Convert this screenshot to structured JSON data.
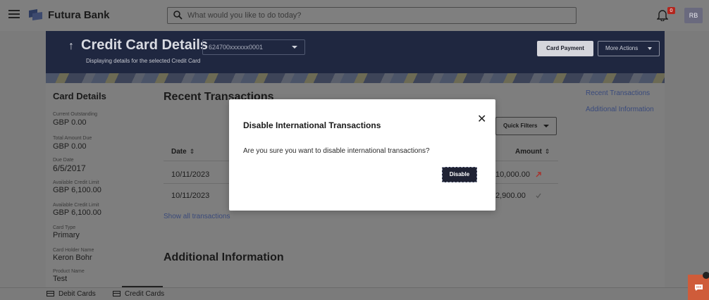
{
  "header": {
    "brand": "Futura Bank",
    "search_placeholder": "What would you like to do today?",
    "notification_count": "0",
    "avatar_initials": "RB"
  },
  "hero": {
    "title": "Credit Card Details",
    "subtitle": "Displaying details for the selected Credit Card",
    "selected_card": "624700xxxxxx0001",
    "card_payment_label": "Card Payment",
    "more_actions_label": "More Actions"
  },
  "card_details": {
    "title": "Card Details",
    "fields": [
      {
        "label": "Current Outstanding",
        "value": "GBP 0.00"
      },
      {
        "label": "Total Amount Due",
        "value": "GBP 0.00"
      },
      {
        "label": "Due Date",
        "value": "6/5/2017"
      },
      {
        "label": "Available Credit Limit",
        "value": "GBP 6,100.00"
      },
      {
        "label": "Available Credit Limit",
        "value": "GBP 6,100.00"
      },
      {
        "label": "Card Type",
        "value": "Primary"
      },
      {
        "label": "Card Holder Name",
        "value": "Keron Bohr"
      },
      {
        "label": "Product Name",
        "value": "Test"
      }
    ]
  },
  "transactions": {
    "title": "Recent Transactions",
    "quick_filters_label": "Quick Filters",
    "columns": [
      "Date",
      "Amount"
    ],
    "rows": [
      {
        "date": "10/11/2023",
        "amount": "10,000.00",
        "direction_icon": "arrow-up-right-icon"
      },
      {
        "date": "10/11/2023",
        "amount": "2,900.00",
        "direction_icon": "check-icon"
      }
    ],
    "show_all_label": "Show all transactions"
  },
  "additional_info": {
    "title": "Additional Information"
  },
  "right_nav": {
    "links": [
      "Recent Transactions",
      "Additional Information"
    ]
  },
  "bottom_tabs": {
    "tabs": [
      "Debit Cards",
      "Credit Cards"
    ],
    "active": "Credit Cards"
  },
  "modal": {
    "title": "Disable International Transactions",
    "message": "Are you sure you want to disable international transactions?",
    "confirm_label": "Disable",
    "close_icon": "close-icon"
  }
}
